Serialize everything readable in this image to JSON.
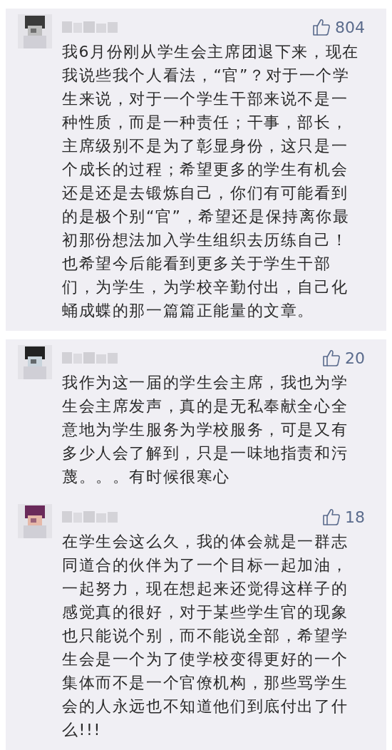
{
  "cards": [
    {
      "comments": [
        {
          "likes": "804",
          "text": "我6月份刚从学生会主席团退下来，现在我说些我个人看法，“官”？对于一个学生来说，对于一个学生干部来说不是一种性质，而是一种责任；干事，部长，主席级别不是为了彰显身份，这只是一个成长的过程；希望更多的学生有机会还是还是去锻炼自己，你们有可能看到的是极个别“官”，希望还是保持离你最初那份想法加入学生组织去历练自己！也希望今后能看到更多关于学生干部们，为学生，为学校辛勤付出，自己化蛹成蝶的那一篇篇正能量的文章。"
        }
      ]
    },
    {
      "comments": [
        {
          "likes": "20",
          "text": "我作为这一届的学生会主席，我也为学生会主席发声，真的是无私奉献全心全意地为学生服务为学校服务，可是又有多少人会了解到，只是一味地指责和污蔑。。。有时候很寒心"
        },
        {
          "likes": "18",
          "text": "在学生会这么久，我的体会就是一群志同道合的伙伴为了一个目标一起加油，一起努力，现在想起来还觉得这样子的感觉真的很好，对于某些学生官的现象也只能说个别，而不能说全部，希望学生会是一个为了使学校变得更好的一个集体而不是一个官僚机构，那些骂学生会的人永远也不知道他们到底付出了什么!!!"
        }
      ]
    }
  ]
}
